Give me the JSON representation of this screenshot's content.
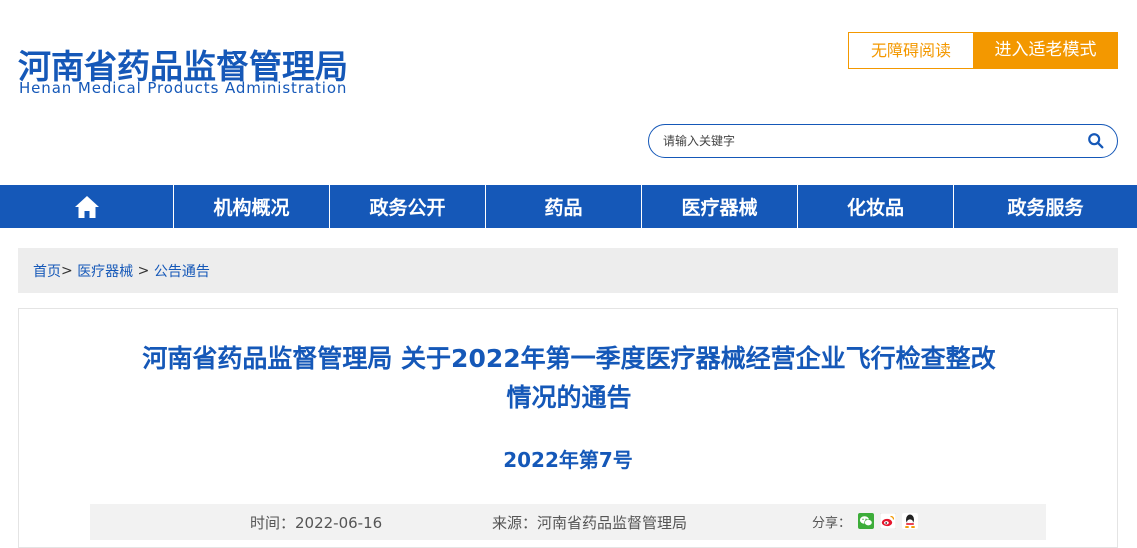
{
  "header": {
    "title_cn": "河南省药品监督管理局",
    "title_en": "Henan Medical Products Administration",
    "accessible_label": "无障碍阅读",
    "elder_mode_label": "进入适老模式"
  },
  "search": {
    "placeholder": "请输入关键字",
    "icon": "search-icon"
  },
  "nav": {
    "home_icon": "home-icon",
    "items": [
      {
        "label": "机构概况"
      },
      {
        "label": "政务公开"
      },
      {
        "label": "药品"
      },
      {
        "label": "医疗器械"
      },
      {
        "label": "化妆品"
      },
      {
        "label": "政务服务"
      }
    ]
  },
  "breadcrumb": {
    "home": "首页",
    "sep1": "> ",
    "level1": "医疗器械",
    "sep2": " > ",
    "level2": "公告通告"
  },
  "article": {
    "title_line1": "河南省药品监督管理局 关于2022年第一季度医疗器械经营企业飞行检查整改",
    "title_line2": "情况的通告",
    "doc_number": "2022年第7号",
    "time": "时间：2022-06-16",
    "source": "来源：河南省药品监督管理局",
    "share_label": "分享：",
    "share_icons": [
      "wechat-icon",
      "weibo-icon",
      "qq-icon"
    ]
  },
  "colors": {
    "brand_blue": "#1558b8",
    "accent_orange": "#f39800",
    "crumb_bg": "#ededed",
    "meta_bg": "#f2f2f2"
  }
}
